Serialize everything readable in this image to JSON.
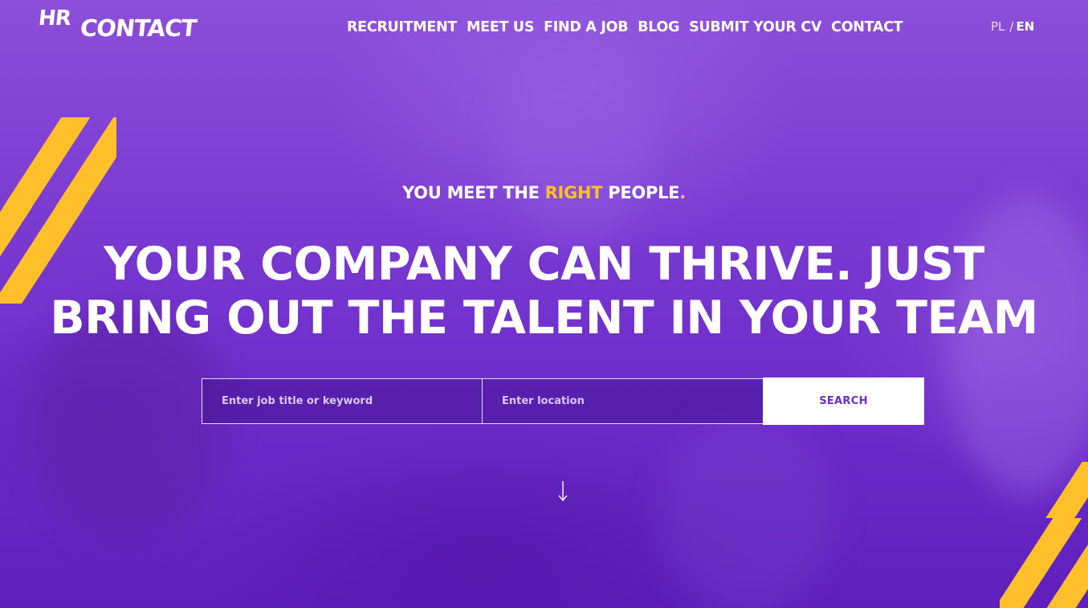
{
  "brand": {
    "logo_text_top": "HR",
    "logo_text_bottom": "CONTACT"
  },
  "nav": {
    "items": [
      {
        "label": "RECRUITMENT"
      },
      {
        "label": "MEET US"
      },
      {
        "label": "FIND A JOB"
      },
      {
        "label": "BLOG"
      },
      {
        "label": "SUBMIT YOUR CV"
      },
      {
        "label": "CONTACT"
      }
    ]
  },
  "language": {
    "pl": "PL",
    "separator": "/",
    "en": "EN",
    "active": "EN"
  },
  "hero": {
    "tagline_before": "YOU MEET THE ",
    "tagline_accent": "RIGHT",
    "tagline_after": " PEOPLE",
    "tagline_dot": ".",
    "headline_line1": "YOUR COMPANY CAN THRIVE. JUST",
    "headline_line2": "BRING OUT THE TALENT IN YOUR TEAM"
  },
  "search": {
    "keyword_placeholder": "Enter job title or keyword",
    "keyword_value": "",
    "location_placeholder": "Enter location",
    "location_value": "",
    "button_label": "SEARCH"
  },
  "icons": {
    "scroll": "arrow-down-icon"
  },
  "colors": {
    "brand_purple": "#6a2bc4",
    "accent_yellow": "#fdc02a",
    "text": "#ffffff"
  }
}
